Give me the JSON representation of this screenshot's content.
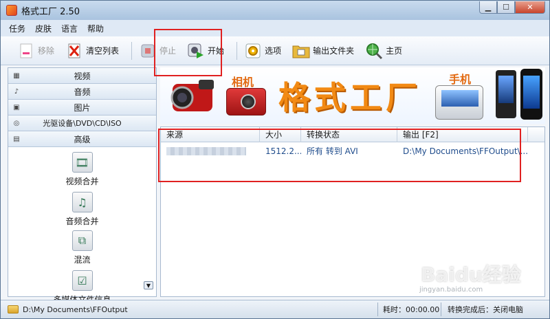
{
  "window": {
    "title": "格式工厂 2.50"
  },
  "menu": [
    "任务",
    "皮肤",
    "语言",
    "帮助"
  ],
  "toolbar": {
    "remove": "移除",
    "clear_list": "清空列表",
    "stop": "停止",
    "start": "开始",
    "options": "选项",
    "output_folder": "输出文件夹",
    "homepage": "主页"
  },
  "sidebar": {
    "categories": [
      {
        "label": "视频",
        "icon": "film-icon"
      },
      {
        "label": "音频",
        "icon": "music-note-icon"
      },
      {
        "label": "图片",
        "icon": "image-icon"
      },
      {
        "label": "光驱设备\\DVD\\CD\\ISO",
        "icon": "disc-icon"
      },
      {
        "label": "高级",
        "icon": "advanced-icon"
      }
    ],
    "tools": [
      {
        "label": "视频合并",
        "icon": "film-reel-icon"
      },
      {
        "label": "音频合并",
        "icon": "audio-file-icon"
      },
      {
        "label": "混流",
        "icon": "mux-icon"
      },
      {
        "label": "多媒体文件信息",
        "icon": "checklist-icon"
      }
    ]
  },
  "banner": {
    "camera_label": "相机",
    "title": "格式工厂",
    "phone_label": "手机"
  },
  "table": {
    "columns": [
      "来源",
      "大小",
      "转换状态",
      "输出 [F2]"
    ],
    "rows": [
      {
        "source": "",
        "size": "1512.2...",
        "status": "所有 转到 AVI",
        "output": "D:\\My Documents\\FFOutput\\..."
      }
    ]
  },
  "status": {
    "output_path": "D:\\My Documents\\FFOutput",
    "elapsed": "耗时：00:00.00",
    "after_done": "转换完成后：关闭电脑"
  },
  "watermark": {
    "brand": "Baidu经验",
    "url": "jingyan.baidu.com"
  }
}
